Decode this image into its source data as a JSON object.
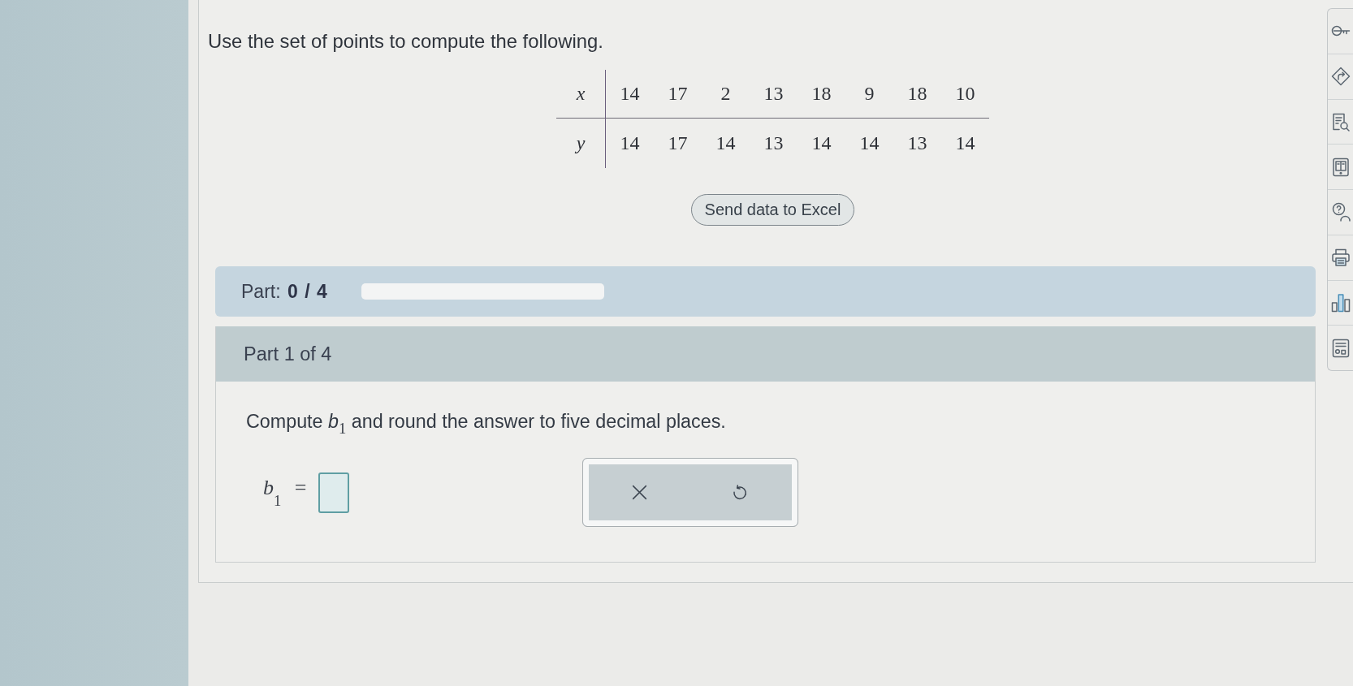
{
  "prompt": "Use the set of points to compute the following.",
  "data_table": {
    "rows": [
      {
        "label": "x",
        "values": [
          "14",
          "17",
          "2",
          "13",
          "18",
          "9",
          "18",
          "10"
        ]
      },
      {
        "label": "y",
        "values": [
          "14",
          "17",
          "14",
          "13",
          "14",
          "14",
          "13",
          "14"
        ]
      }
    ]
  },
  "excel_button": {
    "label": "Send data to Excel"
  },
  "progress": {
    "label": "Part: **0 / 4**",
    "level": 0
  },
  "part": {
    "title": "Part 1 of 4",
    "question": "Compute *b*$_{1}$ and round the answer to five decimal places.",
    "answer_label": "*b*$_{1}$ ="
  }
}
